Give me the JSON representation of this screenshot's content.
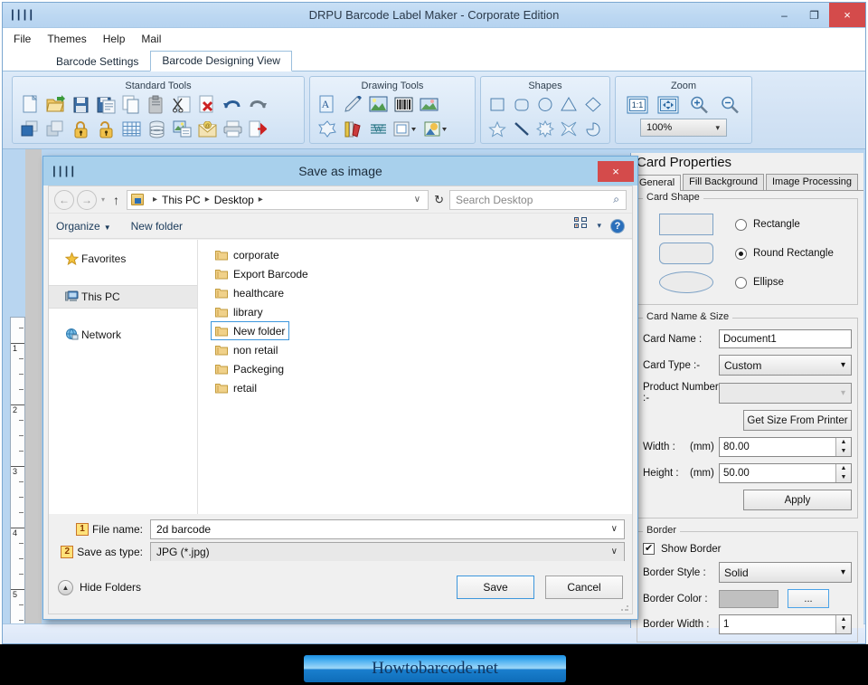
{
  "app": {
    "title": "DRPU Barcode Label Maker - Corporate Edition",
    "icon": "barcode-icon",
    "window_buttons": {
      "minimize": "–",
      "maximize": "❐",
      "close": "×"
    },
    "menu": [
      "File",
      "Themes",
      "Help",
      "Mail"
    ],
    "tabs": [
      {
        "label": "Barcode Settings",
        "active": false
      },
      {
        "label": "Barcode Designing View",
        "active": true
      }
    ],
    "ribbon_groups": [
      {
        "title": "Standard Tools"
      },
      {
        "title": "Drawing Tools"
      },
      {
        "title": "Shapes"
      },
      {
        "title": "Zoom",
        "zoom_value": "100%"
      }
    ],
    "ruler_marks": [
      "1",
      "2",
      "3",
      "4",
      "5"
    ]
  },
  "properties": {
    "title": "Card Properties",
    "tabs": [
      {
        "label": "General",
        "active": true
      },
      {
        "label": "Fill Background",
        "active": false
      },
      {
        "label": "Image Processing",
        "active": false
      }
    ],
    "card_shape": {
      "legend": "Card Shape",
      "options": [
        {
          "label": "Rectangle",
          "selected": false
        },
        {
          "label": "Round Rectangle",
          "selected": true
        },
        {
          "label": "Ellipse",
          "selected": false
        }
      ]
    },
    "card_name_size": {
      "legend": "Card  Name & Size",
      "card_name_label": "Card Name :",
      "card_name_value": "Document1",
      "card_type_label": "Card Type :-",
      "card_type_value": "Custom",
      "product_number_label": "Product Number :-",
      "product_number_value": "",
      "get_size_button": "Get Size From Printer",
      "width_label": "Width :",
      "width_unit": "(mm)",
      "width_value": "80.00",
      "height_label": "Height :",
      "height_unit": "(mm)",
      "height_value": "50.00",
      "apply_button": "Apply"
    },
    "border": {
      "legend": "Border",
      "show_border_label": "Show Border",
      "show_border_checked": true,
      "style_label": "Border Style :",
      "style_value": "Solid",
      "color_label": "Border Color :",
      "color_value": "#c0c0c0",
      "color_button": "...",
      "width_label": "Border Width :",
      "width_value": "1"
    }
  },
  "dialog": {
    "title": "Save as image",
    "icon": "barcode-icon",
    "close_label": "×",
    "nav": {
      "back_icon": "back-arrow-icon",
      "forward_icon": "forward-arrow-icon",
      "recent_icon": "chevron-down-icon",
      "up_icon": "up-arrow-icon",
      "breadcrumbs": [
        "This PC",
        "Desktop"
      ],
      "address_chevron": "∨",
      "refresh_icon": "↻",
      "search_placeholder": "Search Desktop",
      "search_value": "",
      "search_icon": "search-icon"
    },
    "commands": {
      "organize": "Organize",
      "new_folder": "New folder",
      "view_icon": "view-mode-icon",
      "view_caret": "▾",
      "help_icon": "help-icon",
      "help_glyph": "?"
    },
    "nav_pane": [
      {
        "label": "Favorites",
        "icon": "star-icon",
        "selected": false
      },
      {
        "label": "This PC",
        "icon": "computer-icon",
        "selected": true
      },
      {
        "label": "Network",
        "icon": "network-icon",
        "selected": false
      }
    ],
    "files": [
      {
        "name": "corporate",
        "selected": false
      },
      {
        "name": "Export Barcode",
        "selected": false
      },
      {
        "name": "healthcare",
        "selected": false
      },
      {
        "name": "library",
        "selected": false
      },
      {
        "name": "New folder",
        "selected": true
      },
      {
        "name": "non retail",
        "selected": false
      },
      {
        "name": "Packeging",
        "selected": false
      },
      {
        "name": "retail",
        "selected": false
      }
    ],
    "file_name": {
      "badge": "1",
      "label": "File name:",
      "value": "2d barcode",
      "chevron": "∨"
    },
    "save_as_type": {
      "badge": "2",
      "label": "Save as type:",
      "value": "JPG (*.jpg)",
      "chevron": "∨"
    },
    "footer": {
      "hide_folders": "Hide Folders",
      "hide_folders_icon": "▲",
      "save_button": "Save",
      "cancel_button": "Cancel"
    }
  },
  "watermark": {
    "text": "Howtobarcode.net"
  },
  "colors": {
    "titlebar": "#bdd8f2",
    "dialog_title": "#a8d0ec",
    "close_red": "#d44b4b",
    "selection_blue": "#3c96dc",
    "workspace": "#b8d5f0"
  }
}
